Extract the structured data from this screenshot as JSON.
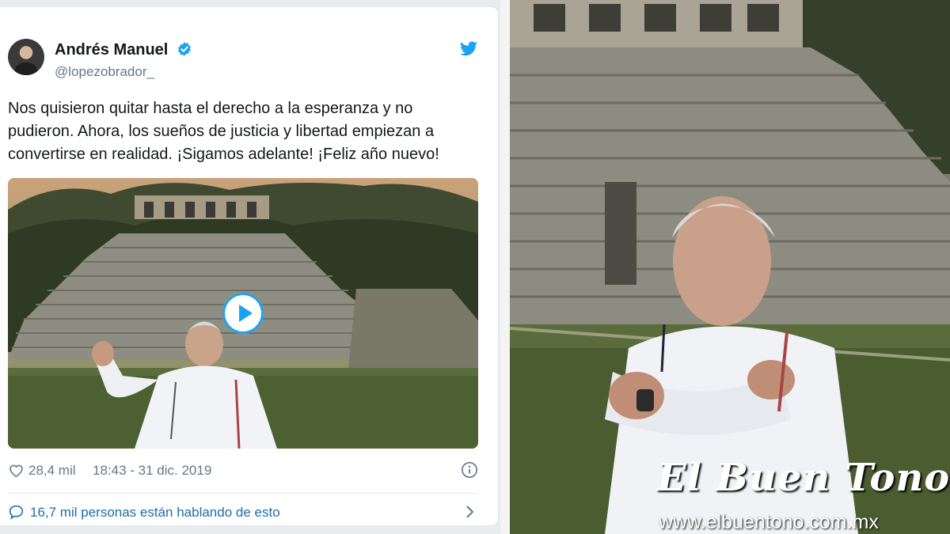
{
  "tweet": {
    "author": {
      "name": "Andrés Manuel",
      "handle": "@lopezobrador_",
      "verified": true
    },
    "text": "Nos quisieron quitar hasta el derecho a la esperanza y no pudieron. Ahora, los sueños de justicia y libertad empiezan a convertirse en realidad. ¡Sigamos adelante! ¡Feliz año nuevo!",
    "media": {
      "type": "video",
      "icon": "play-icon"
    },
    "likes": "28,4 mil",
    "timestamp": "18:43 - 31 dic. 2019",
    "conversation": "16,7 mil personas están hablando de esto",
    "colors": {
      "accent": "#1da1f2",
      "text": "#14171a",
      "muted": "#657786"
    }
  },
  "watermark": {
    "title": "El Buen Tono",
    "url": "www.elbuentono.com.mx"
  }
}
